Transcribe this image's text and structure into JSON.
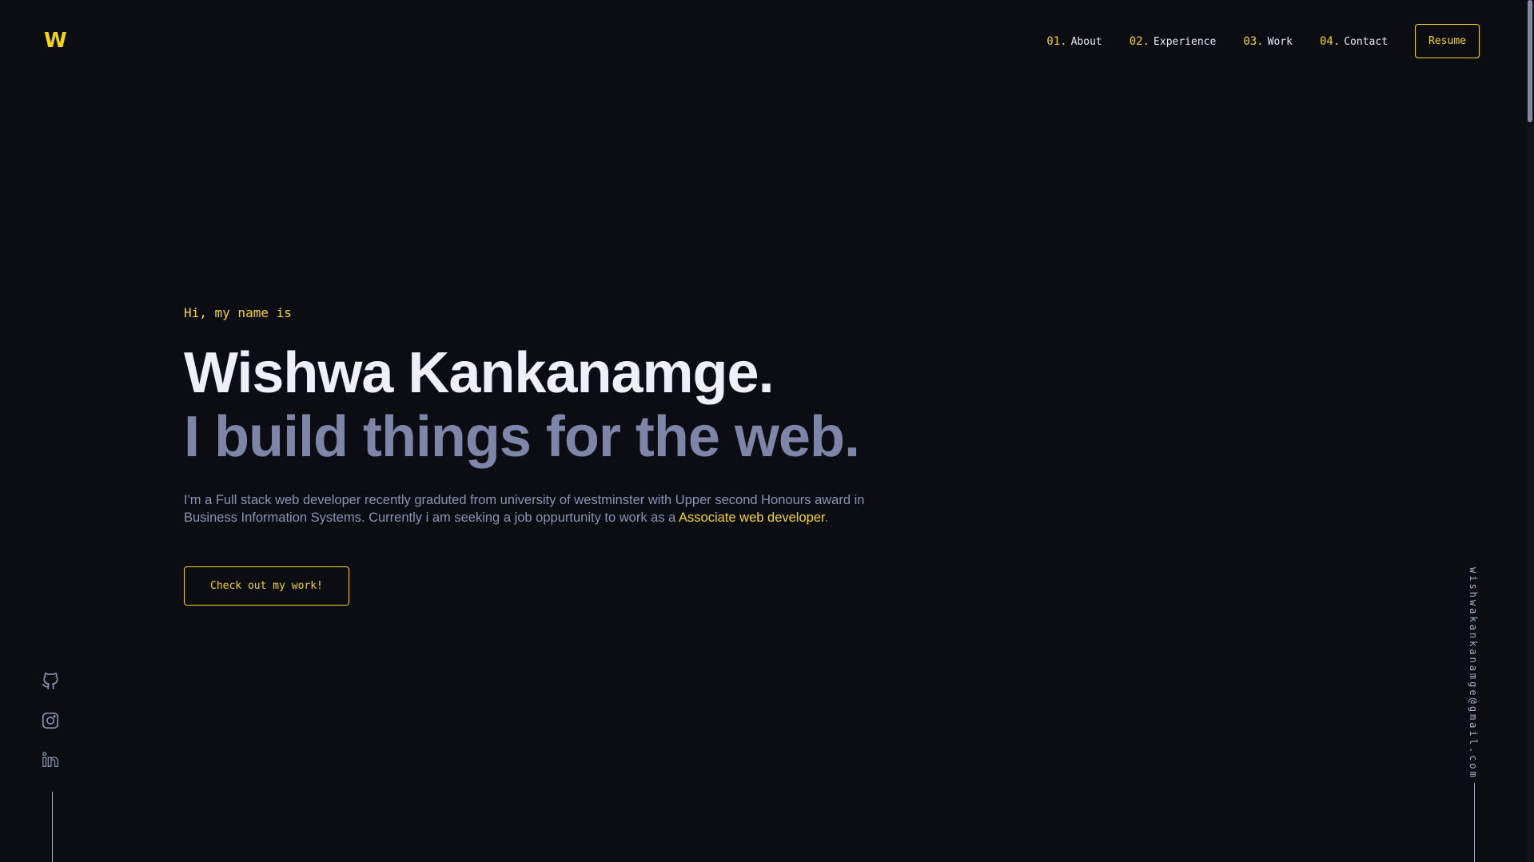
{
  "header": {
    "logo": "W",
    "nav": [
      {
        "num": "01.",
        "label": "About"
      },
      {
        "num": "02.",
        "label": "Experience"
      },
      {
        "num": "03.",
        "label": "Work"
      },
      {
        "num": "04.",
        "label": "Contact"
      }
    ],
    "resume_label": "Resume"
  },
  "hero": {
    "greeting": "Hi, my name is",
    "name": "Wishwa Kankanamge.",
    "tagline": "I build things for the web.",
    "description": "I'm a Full stack web developer recently graduted from university of westminster with Upper second Honours award in Business Information Systems. Currently i am seeking a job oppurtunity to work as a ",
    "highlight": "Associate web developer",
    "description_end": ".",
    "cta_label": "Check out my work!"
  },
  "sidebar": {
    "social": [
      "github-icon",
      "instagram-icon",
      "linkedin-icon"
    ],
    "email": "wishwakankanamge@gmail.com"
  },
  "colors": {
    "accent": "#f3d416",
    "background": "#0b0d13",
    "muted": "#7d86a8"
  }
}
